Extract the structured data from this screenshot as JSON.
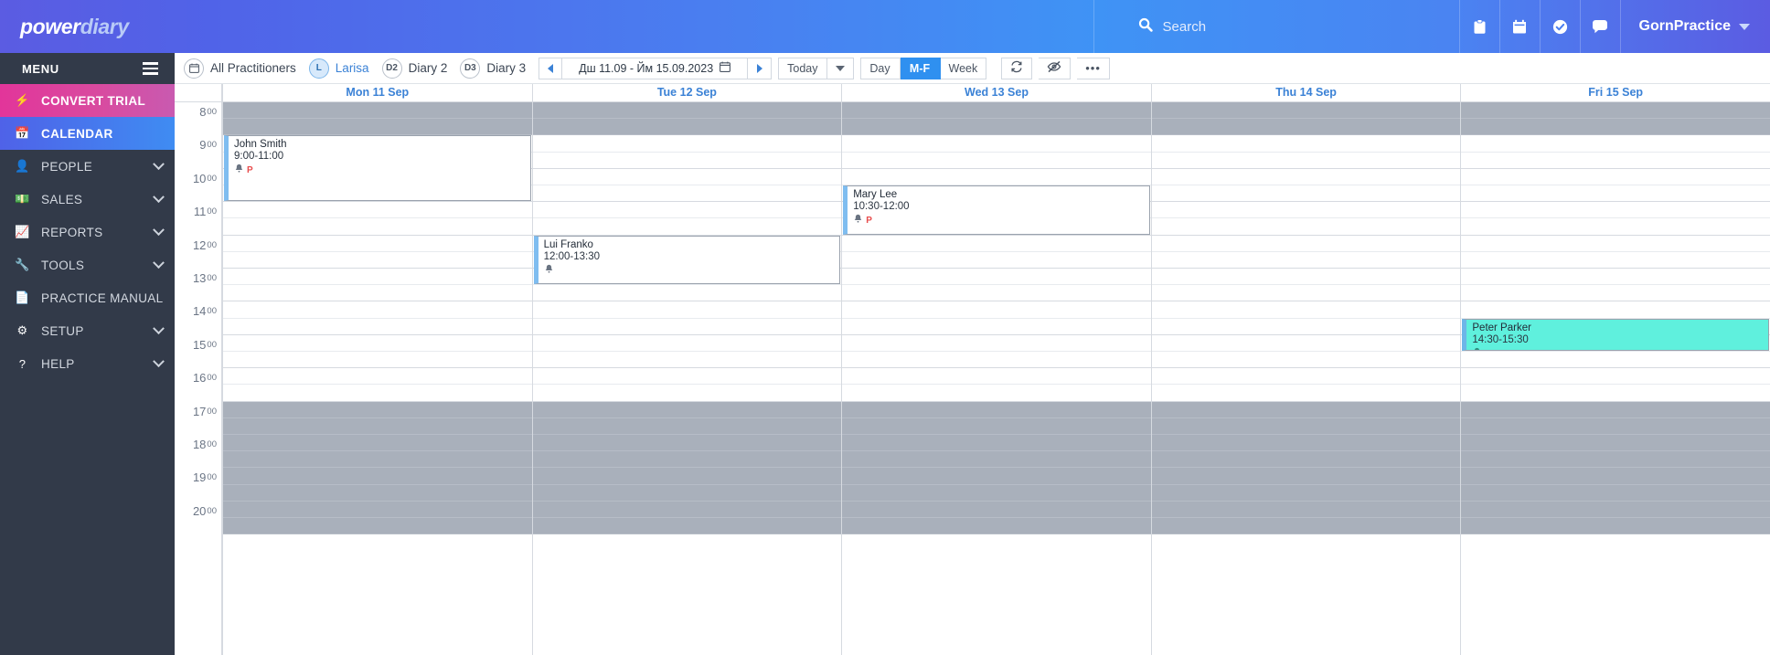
{
  "topbar": {
    "logo_primary": "power",
    "logo_secondary": "diary",
    "search_placeholder": "Search",
    "search_icon": "search-icon",
    "icons": [
      {
        "name": "clipboard-icon",
        "glyph": "📋"
      },
      {
        "name": "calendar-icon",
        "glyph": "📅"
      },
      {
        "name": "check-circle-icon",
        "glyph": "✔"
      },
      {
        "name": "chat-icon",
        "glyph": "💬"
      }
    ],
    "account_label": "GornPractice",
    "brand_accent": "#4a7ef0"
  },
  "sidebar": {
    "heading": "MENU",
    "items": [
      {
        "label": "CONVERT TRIAL",
        "icon": "bolt-icon",
        "glyph": "⚡",
        "state": "promo",
        "chevron": false
      },
      {
        "label": "CALENDAR",
        "icon": "calendar-icon",
        "glyph": "📅",
        "state": "active",
        "chevron": false
      },
      {
        "label": "PEOPLE",
        "icon": "person-icon",
        "glyph": "👤",
        "state": "normal",
        "chevron": true
      },
      {
        "label": "SALES",
        "icon": "money-icon",
        "glyph": "💵",
        "state": "normal",
        "chevron": true
      },
      {
        "label": "REPORTS",
        "icon": "chart-icon",
        "glyph": "📈",
        "state": "normal",
        "chevron": true
      },
      {
        "label": "TOOLS",
        "icon": "wrench-icon",
        "glyph": "🔧",
        "state": "normal",
        "chevron": true
      },
      {
        "label": "PRACTICE MANUAL",
        "icon": "document-icon",
        "glyph": "📄",
        "state": "normal",
        "chevron": false
      },
      {
        "label": "SETUP",
        "icon": "gear-icon",
        "glyph": "⚙",
        "state": "normal",
        "chevron": true
      },
      {
        "label": "HELP",
        "icon": "question-circle-icon",
        "glyph": "?",
        "state": "normal",
        "chevron": true
      }
    ]
  },
  "toolbar": {
    "practitioners": [
      {
        "badge": "cal",
        "label": "All Practitioners",
        "selected": false
      },
      {
        "badge": "L",
        "label": "Larisa",
        "selected": true
      },
      {
        "badge": "D2",
        "label": "Diary 2",
        "selected": false
      },
      {
        "badge": "D3",
        "label": "Diary 3",
        "selected": false
      }
    ],
    "prev_label": "previous-period",
    "next_label": "next-period",
    "date_range": "Дш 11.09 - Йм 15.09.2023",
    "date_picker_icon": "calendar-icon",
    "today_label": "Today",
    "views": [
      {
        "label": "Day",
        "active": false
      },
      {
        "label": "M-F",
        "active": true
      },
      {
        "label": "Week",
        "active": false
      }
    ],
    "refresh_icon": "refresh-icon",
    "hide_icon": "eye-slash-icon",
    "more_label": "•••",
    "active_color": "#2f90f0"
  },
  "calendar": {
    "days": [
      {
        "label": "Mon 11 Sep"
      },
      {
        "label": "Tue 12 Sep"
      },
      {
        "label": "Wed 13 Sep"
      },
      {
        "label": "Thu 14 Sep"
      },
      {
        "label": "Fri 15 Sep"
      }
    ],
    "hours": [
      {
        "hour": "8",
        "minutes": "00"
      },
      {
        "hour": "9",
        "minutes": "00"
      },
      {
        "hour": "10",
        "minutes": "00"
      },
      {
        "hour": "11",
        "minutes": "00"
      },
      {
        "hour": "12",
        "minutes": "00"
      },
      {
        "hour": "13",
        "minutes": "00"
      },
      {
        "hour": "14",
        "minutes": "00"
      },
      {
        "hour": "15",
        "minutes": "00"
      },
      {
        "hour": "16",
        "minutes": "00"
      },
      {
        "hour": "17",
        "minutes": "00"
      },
      {
        "hour": "18",
        "minutes": "00"
      },
      {
        "hour": "19",
        "minutes": "00"
      },
      {
        "hour": "20",
        "minutes": "00"
      }
    ],
    "working_start_hour": 9,
    "working_end_hour": 17,
    "day_start_hour": 8,
    "day_end_hour": 21,
    "events": [
      {
        "name": "John Smith",
        "time": "9:00-11:00",
        "day_index": 0,
        "start_hour": 9.0,
        "end_hour": 11.0,
        "color": "white",
        "icons": [
          {
            "name": "bell-icon",
            "glyph": "🔔",
            "color": "#6a7482"
          },
          {
            "name": "flag-p-icon",
            "glyph": "P",
            "color": "#e84c4c"
          }
        ]
      },
      {
        "name": "Mary Lee",
        "time": "10:30-12:00",
        "day_index": 2,
        "start_hour": 10.5,
        "end_hour": 12.0,
        "color": "white",
        "icons": [
          {
            "name": "bell-icon",
            "glyph": "🔔",
            "color": "#6a7482"
          },
          {
            "name": "flag-p-icon",
            "glyph": "P",
            "color": "#e84c4c"
          }
        ]
      },
      {
        "name": "Lui Franko",
        "time": "12:00-13:30",
        "day_index": 1,
        "start_hour": 12.0,
        "end_hour": 13.5,
        "color": "white",
        "icons": [
          {
            "name": "bell-icon",
            "glyph": "🔔",
            "color": "#6a7482"
          }
        ]
      },
      {
        "name": "Peter Parker",
        "time": "14:30-15:30",
        "day_index": 4,
        "start_hour": 14.5,
        "end_hour": 15.5,
        "color": "teal",
        "icons": [
          {
            "name": "bell-icon",
            "glyph": "🔔",
            "color": "#2f8f80"
          }
        ]
      }
    ]
  }
}
